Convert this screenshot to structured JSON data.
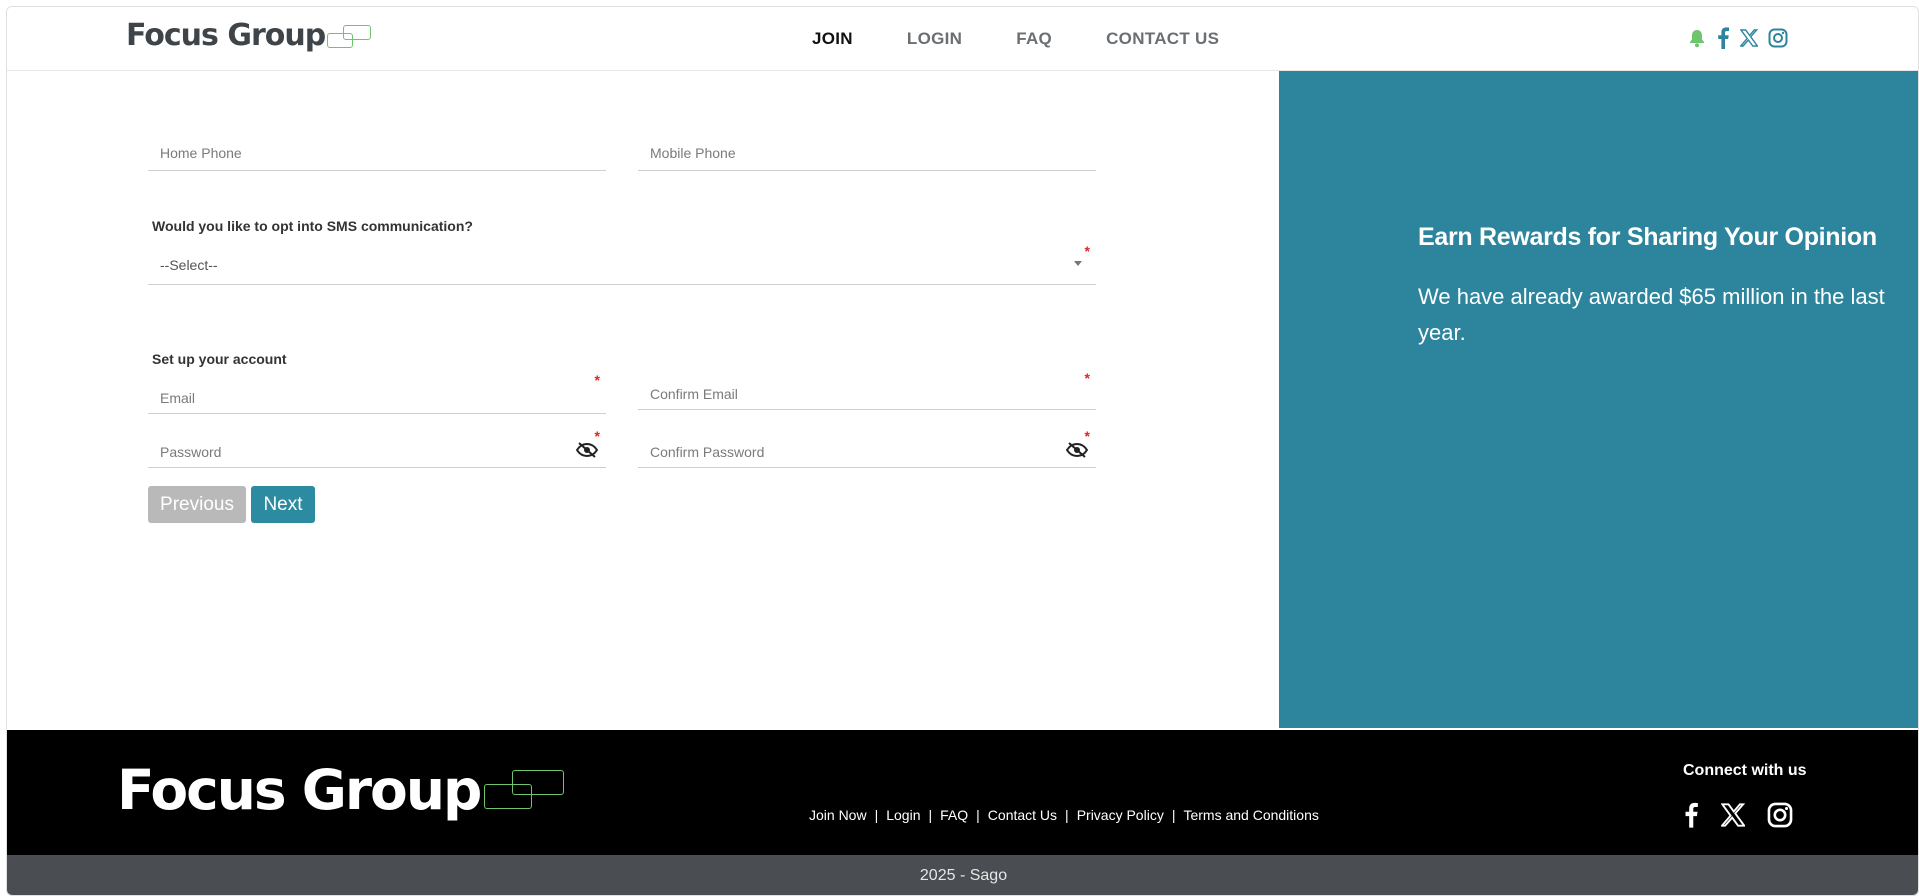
{
  "header": {
    "brand": "Focus Group",
    "nav": [
      {
        "label": "JOIN",
        "active": true
      },
      {
        "label": "LOGIN",
        "active": false
      },
      {
        "label": "FAQ",
        "active": false
      },
      {
        "label": "CONTACT US",
        "active": false
      }
    ],
    "social_icons": [
      "bell-icon",
      "facebook-icon",
      "x-icon",
      "instagram-icon"
    ]
  },
  "form": {
    "home_phone_placeholder": "Home Phone",
    "mobile_phone_placeholder": "Mobile Phone",
    "sms_question": "Would you like to opt into SMS communication?",
    "sms_selected": "--Select--",
    "account_section": "Set up your account",
    "email_placeholder": "Email",
    "confirm_email_placeholder": "Confirm Email",
    "password_placeholder": "Password",
    "confirm_password_placeholder": "Confirm Password",
    "required_marker": "*",
    "previous_label": "Previous",
    "next_label": "Next"
  },
  "promo": {
    "title": "Earn Rewards for Sharing Your Opinion",
    "text": "We have already awarded $65 million in the last year."
  },
  "footer": {
    "brand": "Focus Group",
    "links": [
      "Join Now",
      "Login",
      "FAQ",
      "Contact Us",
      "Privacy Policy",
      "Terms and Conditions"
    ],
    "separator": "|",
    "connect": "Connect with us",
    "copyright": "2025 - Sago"
  },
  "colors": {
    "accent": "#2c859d",
    "logo_green": "#6ec56c",
    "required": "#e02424",
    "footer_bg": "#000000",
    "copyright_bg": "#4a4d52"
  }
}
